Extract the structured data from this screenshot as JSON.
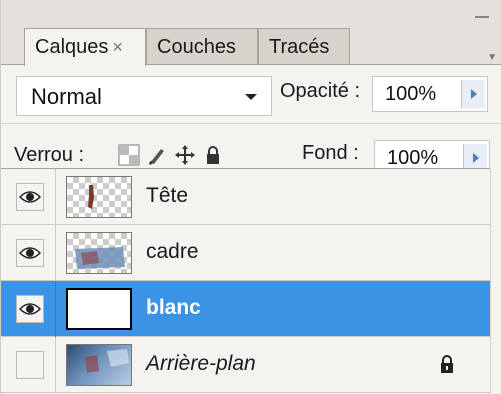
{
  "tabs": [
    {
      "label": "Calques",
      "close": "×",
      "active": true
    },
    {
      "label": "Couches",
      "active": false
    },
    {
      "label": "Tracés",
      "active": false
    }
  ],
  "blend_mode": {
    "value": "Normal"
  },
  "opacity": {
    "label": "Opacité :",
    "value": "100%"
  },
  "lock": {
    "label": "Verrou :",
    "icons": [
      "lock-transparent-icon",
      "lock-brush-icon",
      "lock-move-icon",
      "lock-all-icon"
    ]
  },
  "fill": {
    "label": "Fond :",
    "value": "100%"
  },
  "layers": [
    {
      "name": "Tête",
      "visible": true,
      "selected": false,
      "thumb": "transparent-object"
    },
    {
      "name": "cadre",
      "visible": true,
      "selected": false,
      "thumb": "transparent-frame"
    },
    {
      "name": "blanc",
      "visible": true,
      "selected": true,
      "thumb": "white"
    },
    {
      "name": "Arrière-plan",
      "visible": false,
      "selected": false,
      "thumb": "photo",
      "locked": true,
      "italic": true
    }
  ],
  "colors": {
    "selection": "#3b93e6",
    "panel": "#eceae6",
    "accent_button": "#4a7fb5"
  }
}
